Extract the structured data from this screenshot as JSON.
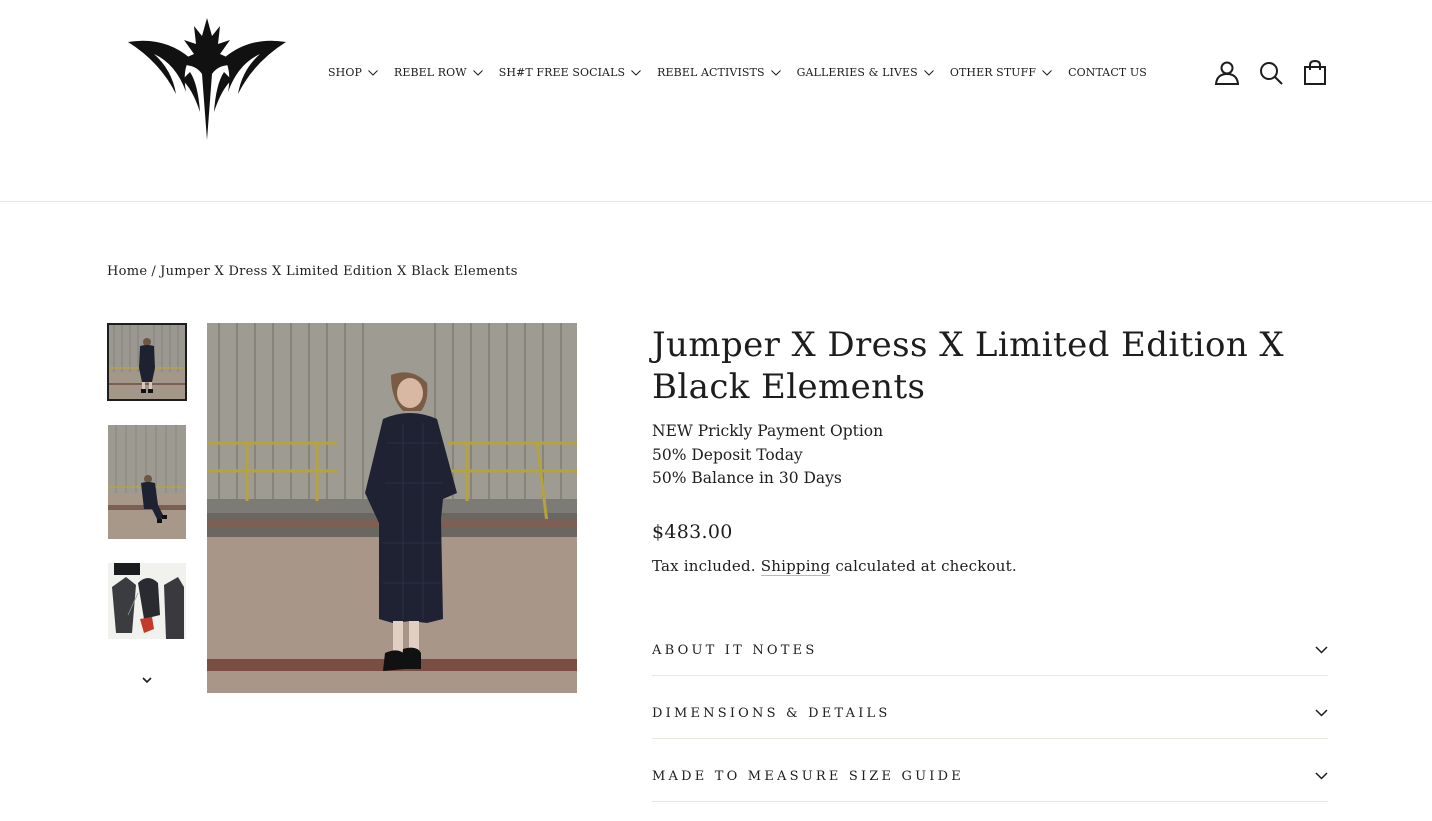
{
  "header": {
    "logo_alt": "Prickly logo",
    "nav": [
      {
        "label": "SHOP",
        "has_dropdown": true
      },
      {
        "label": "REBEL ROW",
        "has_dropdown": true
      },
      {
        "label": "SH#T FREE SOCIALS",
        "has_dropdown": true
      },
      {
        "label": "REBEL ACTIVISTS",
        "has_dropdown": true
      },
      {
        "label": "GALLERIES & LIVES",
        "has_dropdown": true
      },
      {
        "label": "OTHER STUFF",
        "has_dropdown": true
      },
      {
        "label": "CONTACT US",
        "has_dropdown": false
      }
    ],
    "icons": [
      "account-icon",
      "search-icon",
      "cart-icon"
    ]
  },
  "breadcrumb": {
    "home": "Home",
    "separator": "/",
    "current": "Jumper X Dress X Limited Edition X Black Elements"
  },
  "product": {
    "title": "Jumper X Dress X Limited Edition X Black Elements",
    "payment_lines": [
      "NEW Prickly Payment Option",
      "50% Deposit Today",
      "50% Balance in 30 Days"
    ],
    "price": "$483.00",
    "tax_prefix": "Tax included.",
    "tax_link": "Shipping",
    "tax_suffix": "calculated at checkout.",
    "accordion": [
      {
        "label": "ABOUT IT NOTES"
      },
      {
        "label": "DIMENSIONS & DETAILS"
      },
      {
        "label": "MADE TO MEASURE SIZE GUIDE"
      }
    ]
  },
  "colors": {
    "text": "#1c1d1d",
    "border": "#e8e8e1",
    "background": "#ffffff"
  }
}
